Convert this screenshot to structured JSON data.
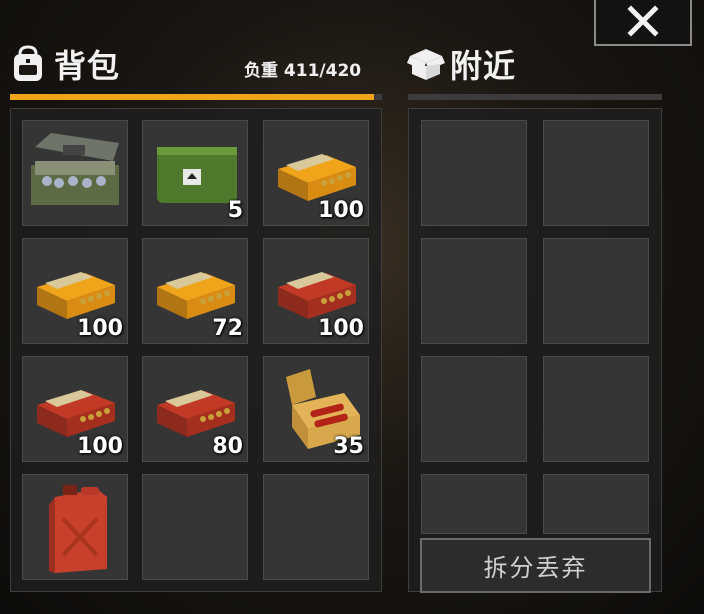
{
  "backpack": {
    "title": "背包",
    "weight_label": "负重 411/420",
    "weight_fraction": 0.979,
    "accent_color": "#f0a41a",
    "slots": [
      {
        "icon": "ammo-crate-icon",
        "qty": ""
      },
      {
        "icon": "green-pouch-icon",
        "qty": "5"
      },
      {
        "icon": "yellow-ammo-box-icon",
        "qty": "100"
      },
      {
        "icon": "yellow-ammo-box-icon",
        "qty": "100"
      },
      {
        "icon": "yellow-ammo-box-icon",
        "qty": "72"
      },
      {
        "icon": "red-ammo-box-icon",
        "qty": "100"
      },
      {
        "icon": "red-ammo-box-icon",
        "qty": "100"
      },
      {
        "icon": "red-ammo-box-icon",
        "qty": "80"
      },
      {
        "icon": "open-shotgun-shell-box-icon",
        "qty": "35"
      },
      {
        "icon": "red-jerrycan-icon",
        "qty": ""
      },
      {
        "icon": "",
        "qty": ""
      },
      {
        "icon": "",
        "qty": ""
      }
    ]
  },
  "nearby": {
    "title": "附近",
    "action_button": "拆分丢弃"
  },
  "close_icon": "close-icon"
}
